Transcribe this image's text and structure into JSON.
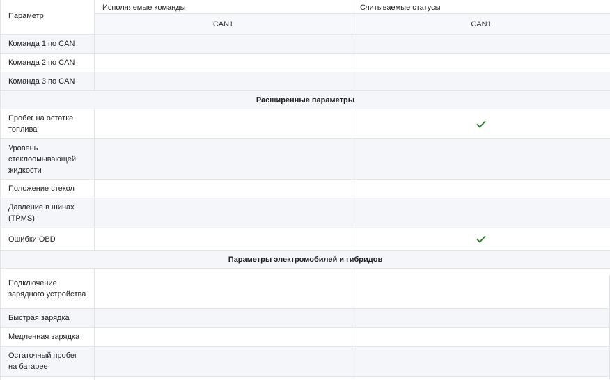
{
  "table": {
    "header": {
      "param": "Параметр",
      "commands": "Исполняемые команды",
      "statuses": "Считываемые статусы",
      "commands_sub": "CAN1",
      "statuses_sub": "CAN1"
    },
    "rows": [
      {
        "type": "row",
        "label": "Команда 1 по CAN",
        "commands": false,
        "statuses": false,
        "h": "h27"
      },
      {
        "type": "row",
        "label": "Команда 2 по CAN",
        "commands": false,
        "statuses": false,
        "h": "h27"
      },
      {
        "type": "row",
        "label": "Команда 3 по CAN",
        "commands": false,
        "statuses": false,
        "h": "h27"
      },
      {
        "type": "section",
        "label": "Расширенные параметры"
      },
      {
        "type": "row",
        "label": "Пробег на остатке топлива",
        "commands": false,
        "statuses": true,
        "h": "h43"
      },
      {
        "type": "row",
        "label": "Уровень стеклоомывающей жидкости",
        "commands": false,
        "statuses": false,
        "h": "h58"
      },
      {
        "type": "row",
        "label": "Положение стекол",
        "commands": false,
        "statuses": false,
        "h": "h27"
      },
      {
        "type": "row",
        "label": "Давление в шинах (TPMS)",
        "commands": false,
        "statuses": false,
        "h": "h43"
      },
      {
        "type": "row",
        "label": "Ошибки OBD",
        "commands": false,
        "statuses": true,
        "h": "h32"
      },
      {
        "type": "section",
        "label": "Параметры электромобилей и гибридов"
      },
      {
        "type": "row",
        "label": "Подключение зарядного устройства",
        "commands": false,
        "statuses": false,
        "h": "h58"
      },
      {
        "type": "row",
        "label": "Быстрая зарядка",
        "commands": false,
        "statuses": false,
        "h": "h27"
      },
      {
        "type": "row",
        "label": "Медленная зарядка",
        "commands": false,
        "statuses": false,
        "h": "h27"
      },
      {
        "type": "row",
        "label": "Остаточный пробег на батарее",
        "commands": false,
        "statuses": false,
        "h": "h43"
      },
      {
        "type": "row",
        "label": "",
        "commands": false,
        "statuses": false,
        "h": "h27"
      }
    ],
    "check_icon": "checkmark-icon",
    "check_color": "#1f7a1f"
  }
}
